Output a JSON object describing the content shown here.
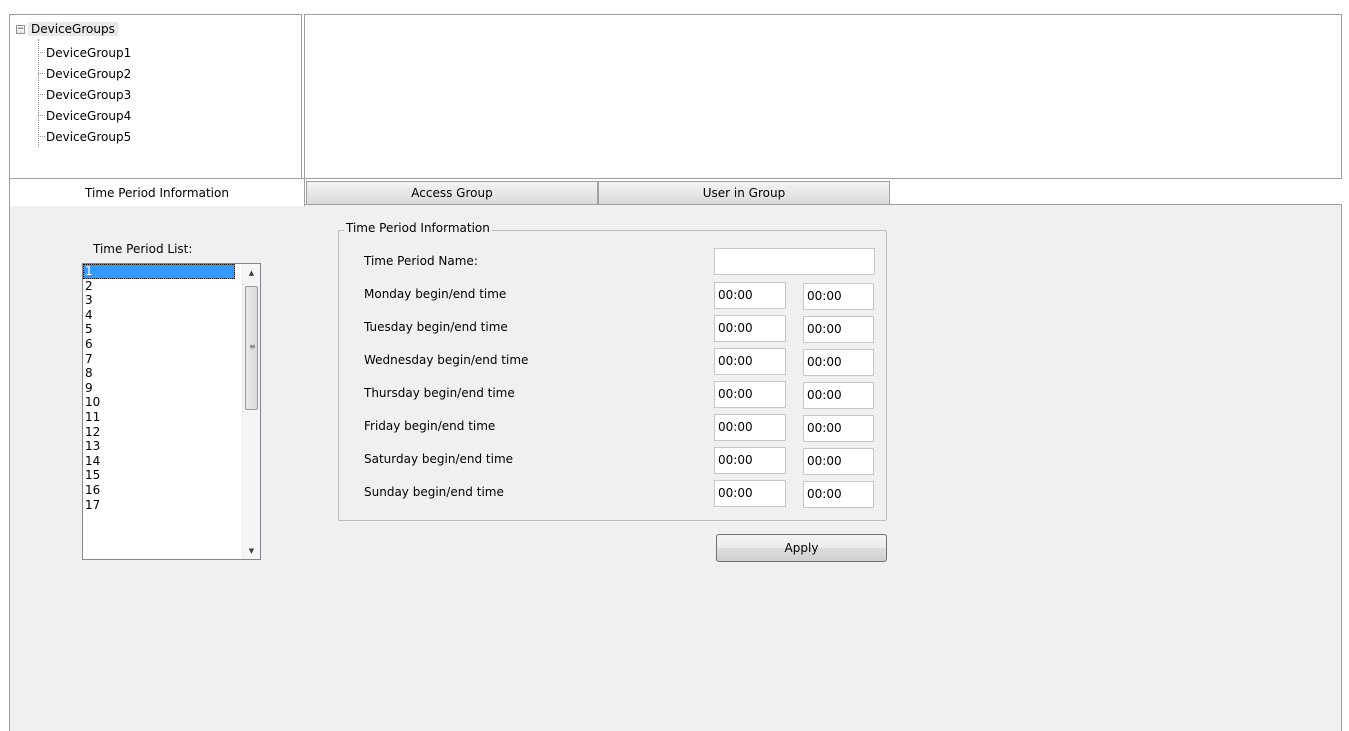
{
  "tree": {
    "root": "DeviceGroups",
    "children": [
      "DeviceGroup1",
      "DeviceGroup2",
      "DeviceGroup3",
      "DeviceGroup4",
      "DeviceGroup5"
    ]
  },
  "tabs": [
    {
      "label": "Time Period Information",
      "active": true
    },
    {
      "label": "Access Group",
      "active": false
    },
    {
      "label": "User in Group",
      "active": false
    }
  ],
  "time_period_list": {
    "label": "Time Period List:",
    "items": [
      "1",
      "2",
      "3",
      "4",
      "5",
      "6",
      "7",
      "8",
      "9",
      "10",
      "11",
      "12",
      "13",
      "14",
      "15",
      "16",
      "17"
    ],
    "selected": "1"
  },
  "info_group": {
    "title": "Time Period Information",
    "name_label": "Time Period Name:",
    "name_value": "",
    "days": [
      {
        "label": "Monday begin/end time",
        "begin": "00:00",
        "end": "00:00"
      },
      {
        "label": "Tuesday begin/end time",
        "begin": "00:00",
        "end": "00:00"
      },
      {
        "label": "Wednesday begin/end time",
        "begin": "00:00",
        "end": "00:00"
      },
      {
        "label": "Thursday begin/end time",
        "begin": "00:00",
        "end": "00:00"
      },
      {
        "label": "Friday begin/end time",
        "begin": "00:00",
        "end": "00:00"
      },
      {
        "label": "Saturday begin/end time",
        "begin": "00:00",
        "end": "00:00"
      },
      {
        "label": "Sunday begin/end time",
        "begin": "00:00",
        "end": "00:00"
      }
    ]
  },
  "apply_label": "Apply",
  "icons": {
    "expander": "collapse-icon",
    "scroll_up": "scroll-up-arrow-icon",
    "scroll_down": "scroll-down-arrow-icon",
    "scroll_grip": "scroll-grip-icon"
  },
  "colors": {
    "selection": "#3399ff",
    "panel_bg": "#f0f0f0",
    "border": "#a0a0a0"
  }
}
